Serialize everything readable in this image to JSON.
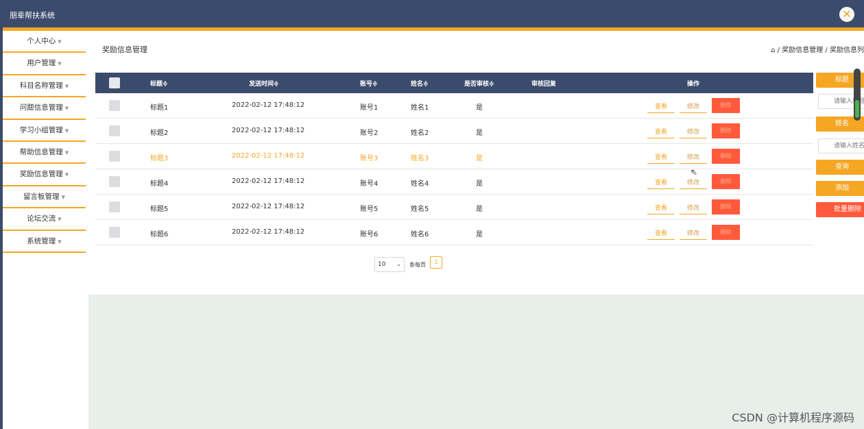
{
  "app": {
    "title": "朋辈帮扶系统"
  },
  "sidebar": {
    "items": [
      {
        "label": "个人中心"
      },
      {
        "label": "用户管理"
      },
      {
        "label": "科目名称管理"
      },
      {
        "label": "问题信息管理"
      },
      {
        "label": "学习小组管理"
      },
      {
        "label": "帮助信息管理"
      },
      {
        "label": "奖励信息管理"
      },
      {
        "label": "留言板管理"
      },
      {
        "label": "论坛交流"
      },
      {
        "label": "系统管理"
      }
    ]
  },
  "main": {
    "page_title": "奖励信息管理",
    "breadcrumb": "⌂ / 奖励信息管理 / 奖励信息列"
  },
  "table": {
    "headers": {
      "title": "标题≑",
      "send_time": "发送时间≑",
      "account": "账号≑",
      "name": "姓名≑",
      "reviewed": "是否审核≑",
      "reply": "审核回复",
      "ops": "操作"
    },
    "rows": [
      {
        "title": "标题1",
        "time": "2022-02-12 17:48:12",
        "account": "账号1",
        "name": "姓名1",
        "reviewed": "是"
      },
      {
        "title": "标题2",
        "time": "2022-02-12 17:48:12",
        "account": "账号2",
        "name": "姓名2",
        "reviewed": "是"
      },
      {
        "title": "标题3",
        "time": "2022-02-12 17:48:12",
        "account": "账号3",
        "name": "姓名3",
        "reviewed": "是"
      },
      {
        "title": "标题4",
        "time": "2022-02-12 17:48:12",
        "account": "账号4",
        "name": "姓名4",
        "reviewed": "是"
      },
      {
        "title": "标题5",
        "time": "2022-02-12 17:48:12",
        "account": "账号5",
        "name": "姓名5",
        "reviewed": "是"
      },
      {
        "title": "标题6",
        "time": "2022-02-12 17:48:12",
        "account": "账号6",
        "name": "姓名6",
        "reviewed": "是"
      }
    ],
    "actions": {
      "view": "查看",
      "edit": "修改",
      "delete": "删除"
    }
  },
  "pager": {
    "page_size": "10",
    "per_page_label": "条每页",
    "current_page": "1"
  },
  "search": {
    "title_label": "标题",
    "title_placeholder": "请输入标题",
    "name_label": "姓名",
    "name_placeholder": "请输入姓名",
    "query": "查询",
    "add": "添加",
    "batch_delete": "批量删除"
  },
  "watermark": "CSDN @计算机程序源码",
  "colors": {
    "header": "#3b4b6c",
    "accent": "#f5a623",
    "danger": "#ff5a3c"
  }
}
